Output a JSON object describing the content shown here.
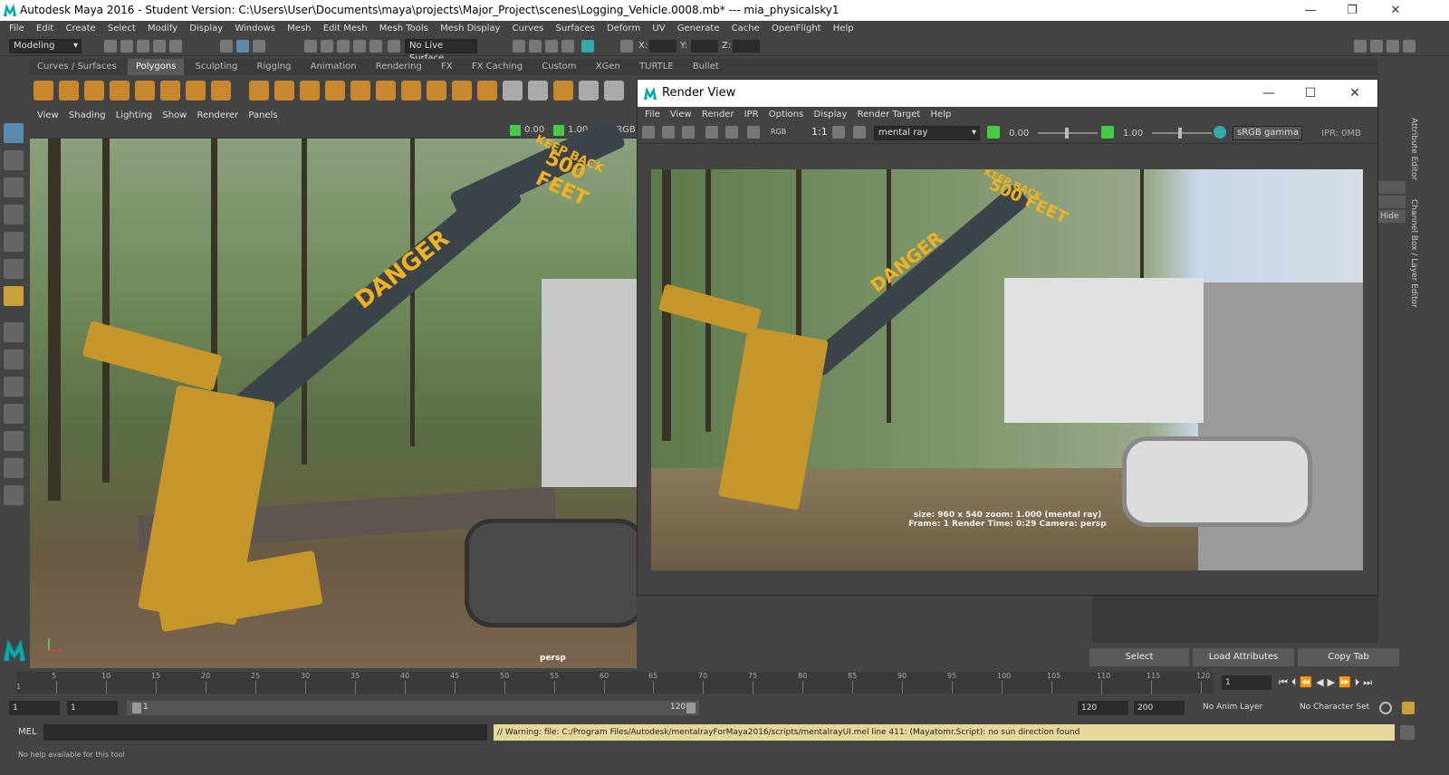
{
  "window": {
    "title": "Autodesk Maya 2016 - Student Version: C:\\Users\\User\\Documents\\maya\\projects\\Major_Project\\scenes\\Logging_Vehicle.0008.mb*   ---   mia_physicalsky1"
  },
  "menubar": [
    "File",
    "Edit",
    "Create",
    "Select",
    "Modify",
    "Display",
    "Windows",
    "Mesh",
    "Edit Mesh",
    "Mesh Tools",
    "Mesh Display",
    "Curves",
    "Surfaces",
    "Deform",
    "UV",
    "Generate",
    "Cache",
    "OpenFlight",
    "Help"
  ],
  "statusline": {
    "menuset": "Modeling",
    "live_surface": "No Live Surface",
    "x_label": "X:",
    "y_label": "Y:",
    "z_label": "Z:"
  },
  "shelf_tabs": [
    "Curves / Surfaces",
    "Polygons",
    "Sculpting",
    "Rigging",
    "Animation",
    "Rendering",
    "FX",
    "FX Caching",
    "Custom",
    "XGen",
    "TURTLE",
    "Bullet"
  ],
  "shelf_active": "Polygons",
  "viewport": {
    "menu": [
      "View",
      "Shading",
      "Lighting",
      "Show",
      "Renderer",
      "Panels"
    ],
    "near": "0.00",
    "far": "1.00",
    "color_space": "sRGB",
    "camera_label": "persp",
    "decal_danger": "DANGER",
    "decal_keepback": "KEEP BACK",
    "decal_500": "500 FEET"
  },
  "render_view": {
    "title": "Render View",
    "menu": [
      "File",
      "View",
      "Render",
      "IPR",
      "Options",
      "Display",
      "Render Target",
      "Help"
    ],
    "ratio": "1:1",
    "rgb": "RGB",
    "renderer": "mental ray",
    "exposure": "0.00",
    "gamma": "1.00",
    "color_mgmt": "sRGB gamma",
    "ipr": "IPR: 0MB",
    "info_line1": "size: 960 x 540  zoom: 1.000        (mental ray)",
    "info_line2": "Frame: 1      Render Time: 0:29      Camera: persp"
  },
  "right_panel": {
    "tabs": [
      "Attribute Editor",
      "Channel Box / Layer Editor"
    ],
    "hide": "Hide",
    "select": "Select",
    "load_attributes": "Load Attributes",
    "copy_tab": "Copy Tab"
  },
  "timeline": {
    "ticks": [
      "5",
      "10",
      "15",
      "20",
      "25",
      "30",
      "35",
      "40",
      "45",
      "50",
      "55",
      "60",
      "65",
      "70",
      "75",
      "80",
      "85",
      "90",
      "95",
      "100",
      "105",
      "110",
      "115",
      "120"
    ],
    "start_marker": "1",
    "current_frame": "1"
  },
  "range": {
    "start": "1",
    "playback_start": "1",
    "slider_start": "1",
    "slider_end": "120",
    "playback_end": "120",
    "end": "200",
    "anim_layer": "No Anim Layer",
    "character_set": "No Character Set"
  },
  "command": {
    "mode": "MEL",
    "warning": "// Warning: file: C:/Program Files/Autodesk/mentalrayForMaya2016/scripts/mentalrayUI.mel line 411: (Mayatomr.Script): no sun direction found"
  },
  "helpline": "No help available for this tool"
}
